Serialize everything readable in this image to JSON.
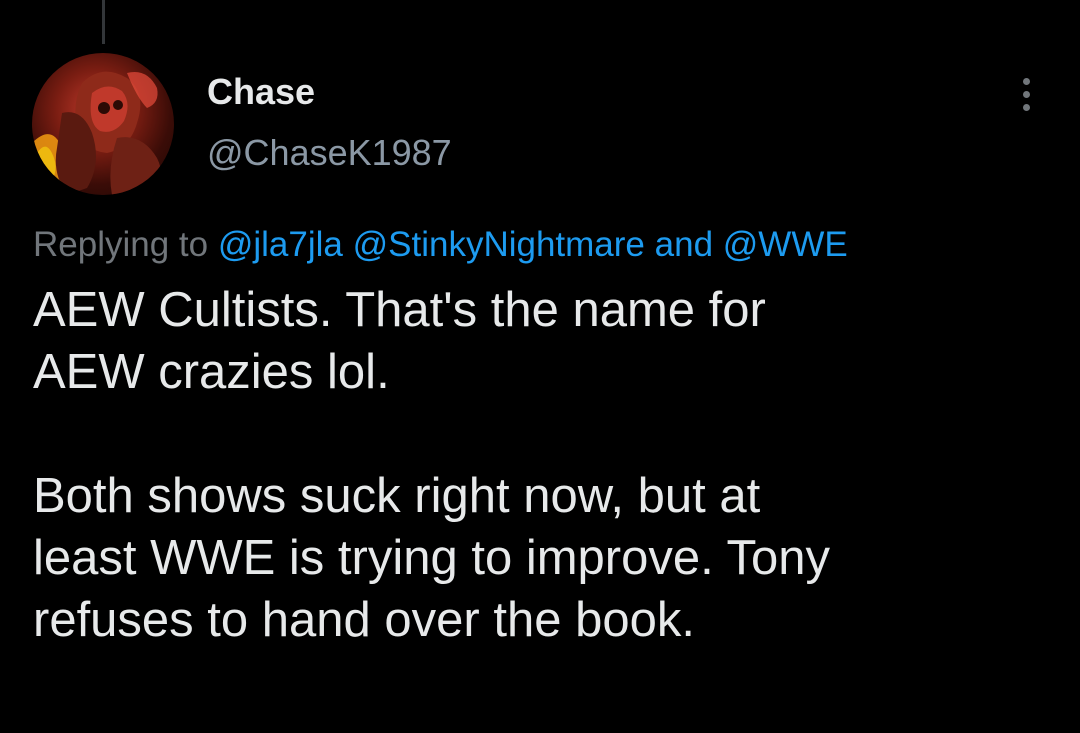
{
  "author": {
    "display_name": "Chase",
    "handle": "@ChaseK1987",
    "avatar_icon": "avatar-image"
  },
  "reply": {
    "prefix": "Replying to",
    "mentions": [
      "@jla7jla",
      "@StinkyNightmare",
      "@WWE"
    ],
    "conjunction": "and"
  },
  "tweet": {
    "paragraphs": [
      "AEW Cultists. That's the name for\nAEW crazies lol.",
      "Both shows suck right now, but at\nleast WWE is trying to improve. Tony\nrefuses to hand over the book."
    ]
  },
  "colors": {
    "background": "#000000",
    "text_primary": "#e7e9ea",
    "text_secondary": "#71767b",
    "accent_link": "#1d9bf0"
  },
  "icons": {
    "more": "more-vertical-icon"
  }
}
